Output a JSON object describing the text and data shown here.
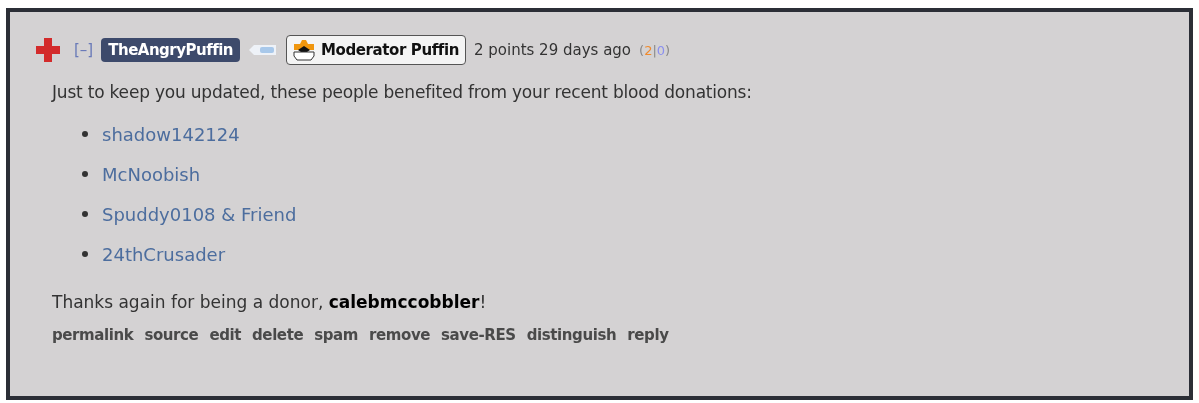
{
  "comment": {
    "collapse": "[–]",
    "author": "TheAngryPuffin",
    "flair": "Moderator Puffin",
    "score": "2 points",
    "age": "29 days ago",
    "votes": {
      "open": "(",
      "up": "2",
      "sep": "|",
      "down": "0",
      "close": ")"
    },
    "body": "Just to keep you updated, these people benefited from your recent blood donations:",
    "people": [
      "shadow142124",
      "McNoobish",
      "Spuddy0108 & Friend",
      "24thCrusader"
    ],
    "thanks": "Thanks again for being a donor, **calebmccobbler**!",
    "actions": [
      "permalink",
      "source",
      "edit",
      "delete",
      "spam",
      "remove",
      "save-RES",
      "distinguish",
      "reply"
    ]
  }
}
